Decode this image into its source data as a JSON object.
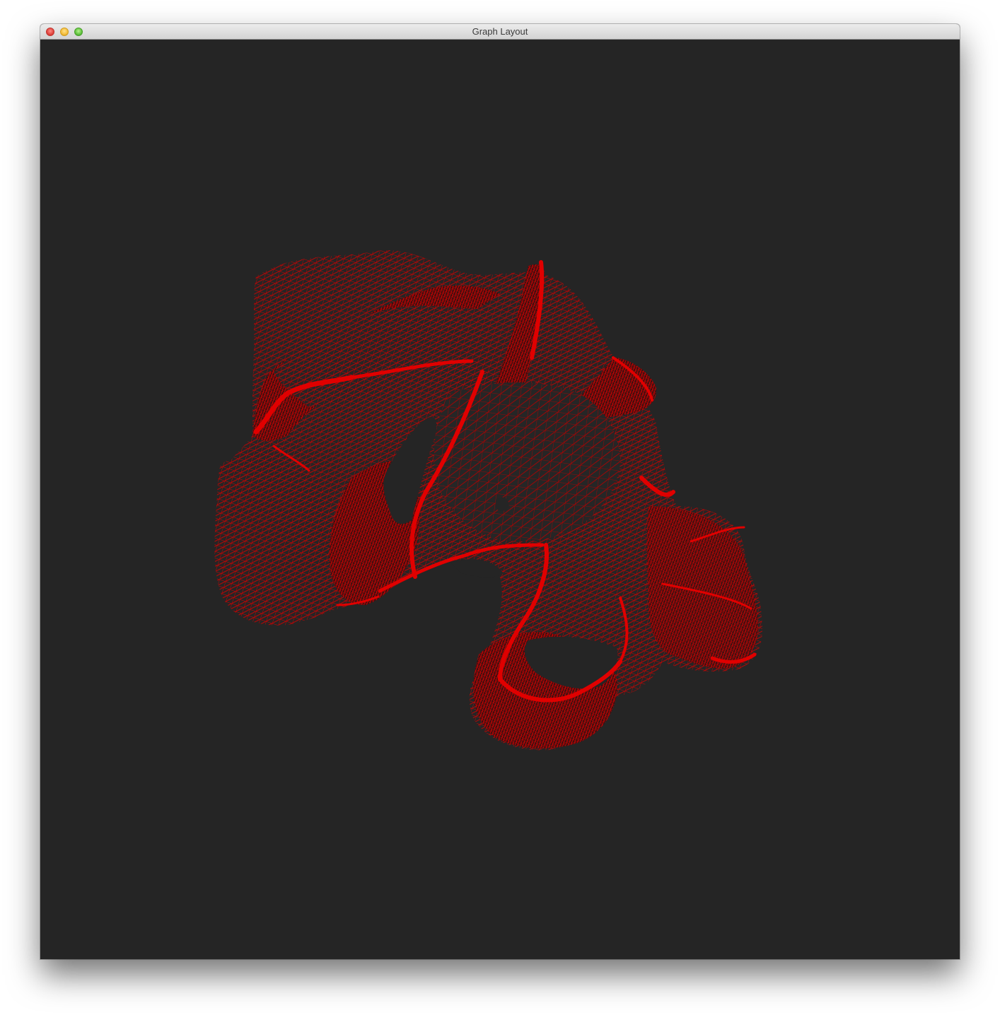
{
  "window": {
    "title": "Graph Layout"
  },
  "colors": {
    "background": "#252525",
    "mesh_stroke": "#e00000",
    "mesh_edge_dense": "#cc0000"
  },
  "icons": {
    "close": "close-traffic-light-icon",
    "minimize": "minimize-traffic-light-icon",
    "zoom": "zoom-traffic-light-icon"
  }
}
